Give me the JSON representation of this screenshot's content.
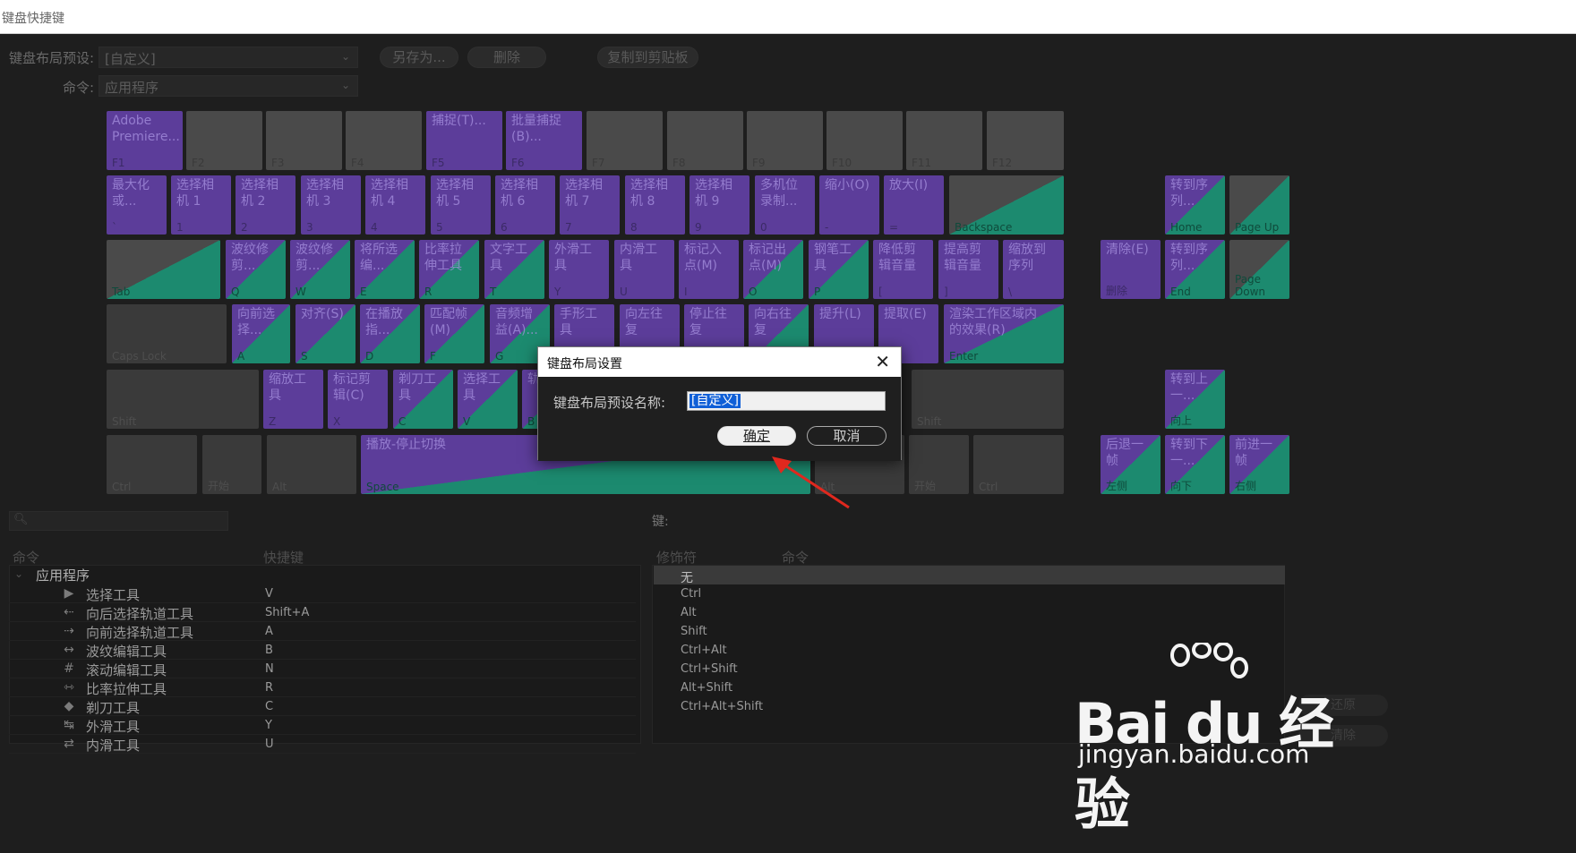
{
  "window": {
    "title": "键盘快捷键"
  },
  "toolbar": {
    "preset_label": "键盘布局预设:",
    "preset_value": "[自定义]",
    "command_label": "命令:",
    "command_value": "应用程序",
    "save_as": "另存为...",
    "delete": "删除",
    "copy_clipboard": "复制到剪贴板"
  },
  "keys": {
    "f1": {
      "label": "Adobe\nPremiere...",
      "base": "F1"
    },
    "f2": {
      "label": "",
      "base": "F2"
    },
    "f3": {
      "label": "",
      "base": "F3"
    },
    "f4": {
      "label": "",
      "base": "F4"
    },
    "f5": {
      "label": "捕捉(T)...",
      "base": "F5"
    },
    "f6": {
      "label": "批量捕捉\n(B)...",
      "base": "F6"
    },
    "f7": {
      "label": "",
      "base": "F7"
    },
    "f8": {
      "label": "",
      "base": "F8"
    },
    "f9": {
      "label": "",
      "base": "F9"
    },
    "f10": {
      "label": "",
      "base": "F10"
    },
    "f11": {
      "label": "",
      "base": "F11"
    },
    "f12": {
      "label": "",
      "base": "F12"
    },
    "grave": {
      "label": "最大化\n或...",
      "base": "`"
    },
    "k1": {
      "label": "选择相\n机 1",
      "base": "1"
    },
    "k2": {
      "label": "选择相\n机 2",
      "base": "2"
    },
    "k3": {
      "label": "选择相\n机 3",
      "base": "3"
    },
    "k4": {
      "label": "选择相\n机 4",
      "base": "4"
    },
    "k5": {
      "label": "选择相\n机 5",
      "base": "5"
    },
    "k6": {
      "label": "选择相\n机 6",
      "base": "6"
    },
    "k7": {
      "label": "选择相\n机 7",
      "base": "7"
    },
    "k8": {
      "label": "选择相\n机 8",
      "base": "8"
    },
    "k9": {
      "label": "选择相\n机 9",
      "base": "9"
    },
    "k0": {
      "label": "多机位\n录制...",
      "base": "0"
    },
    "minus": {
      "label": "缩小(O)",
      "base": "-"
    },
    "equal": {
      "label": "放大(I)",
      "base": "="
    },
    "backspace": {
      "label": "",
      "base": "Backspace"
    },
    "tab": {
      "label": "",
      "base": "Tab"
    },
    "q": {
      "label": "波纹修\n剪...",
      "base": "Q"
    },
    "w": {
      "label": "波纹修\n剪...",
      "base": "W"
    },
    "e": {
      "label": "将所选\n编...",
      "base": "E"
    },
    "r": {
      "label": "比率拉\n伸工具",
      "base": "R"
    },
    "t": {
      "label": "文字工\n具",
      "base": "T"
    },
    "y": {
      "label": "外滑工\n具",
      "base": "Y"
    },
    "u": {
      "label": "内滑工\n具",
      "base": "U"
    },
    "i": {
      "label": "标记入\n点(M)",
      "base": "I"
    },
    "o": {
      "label": "标记出\n点(M)",
      "base": "O"
    },
    "p": {
      "label": "钢笔工\n具",
      "base": "P"
    },
    "lbracket": {
      "label": "降低剪\n辑音量",
      "base": "["
    },
    "rbracket": {
      "label": "提高剪\n辑音量",
      "base": "]"
    },
    "backslash": {
      "label": "缩放到\n序列",
      "base": "\\"
    },
    "capslock": {
      "label": "",
      "base": "Caps Lock"
    },
    "a": {
      "label": "向前选\n择...",
      "base": "A"
    },
    "s": {
      "label": "对齐(S)",
      "base": "S"
    },
    "d": {
      "label": "在播放\n指...",
      "base": "D"
    },
    "f": {
      "label": "匹配帧\n(M)",
      "base": "F"
    },
    "g": {
      "label": "音频增\n益(A)...",
      "base": "G"
    },
    "h": {
      "label": "手形工\n具",
      "base": "H"
    },
    "j": {
      "label": "向左往\n复",
      "base": "J"
    },
    "k": {
      "label": "停止往\n复",
      "base": "K"
    },
    "l": {
      "label": "向右往\n复",
      "base": "L"
    },
    "semicolon": {
      "label": "提升(L)",
      "base": ";"
    },
    "quote": {
      "label": "提取(E)",
      "base": "'"
    },
    "enter": {
      "label": "渲染工作区域内\n的效果(R)",
      "base": "Enter"
    },
    "lshift": {
      "label": "",
      "base": "Shift"
    },
    "z": {
      "label": "缩放工\n具",
      "base": "Z"
    },
    "x": {
      "label": "标记剪\n辑(C)",
      "base": "X"
    },
    "c": {
      "label": "剃刀工\n具",
      "base": "C"
    },
    "v": {
      "label": "选择工\n具",
      "base": "V"
    },
    "b": {
      "label": "轨...",
      "base": "B"
    },
    "rshift": {
      "label": "",
      "base": "Shift"
    },
    "lctrl": {
      "label": "",
      "base": "Ctrl"
    },
    "lwin": {
      "label": "",
      "base": "开始"
    },
    "lalt": {
      "label": "",
      "base": "Alt"
    },
    "space": {
      "label": "播放-停止切换",
      "base": "Space"
    },
    "ralt": {
      "label": "",
      "base": "Alt"
    },
    "rwin": {
      "label": "",
      "base": "开始"
    },
    "rctrl": {
      "label": "",
      "base": "Ctrl"
    },
    "home": {
      "label": "转到序\n列...",
      "base": "Home"
    },
    "pageup": {
      "label": "",
      "base": "Page Up"
    },
    "delete": {
      "label": "清除(E)",
      "base": "删除"
    },
    "end": {
      "label": "转到序\n列...",
      "base": "End"
    },
    "pagedown": {
      "label": "",
      "base": "Page\nDown"
    },
    "up": {
      "label": "转到上\n一...",
      "base": "向上"
    },
    "left": {
      "label": "后退一\n帧",
      "base": "左侧"
    },
    "down": {
      "label": "转到下\n一...",
      "base": "向下"
    },
    "right": {
      "label": "前进一\n帧",
      "base": "右侧"
    }
  },
  "commands": {
    "header_command": "命令",
    "header_shortcut": "快捷键",
    "group": "应用程序",
    "rows": [
      {
        "name": "选择工具",
        "shortcut": "V",
        "icon": "▶"
      },
      {
        "name": "向后选择轨道工具",
        "shortcut": "Shift+A",
        "icon": "⇠"
      },
      {
        "name": "向前选择轨道工具",
        "shortcut": "A",
        "icon": "⇢"
      },
      {
        "name": "波纹编辑工具",
        "shortcut": "B",
        "icon": "↔"
      },
      {
        "name": "滚动编辑工具",
        "shortcut": "N",
        "icon": "#"
      },
      {
        "name": "比率拉伸工具",
        "shortcut": "R",
        "icon": "⇿"
      },
      {
        "name": "剃刀工具",
        "shortcut": "C",
        "icon": "◆"
      },
      {
        "name": "外滑工具",
        "shortcut": "Y",
        "icon": "↹"
      },
      {
        "name": "内滑工具",
        "shortcut": "U",
        "icon": "⇄"
      }
    ]
  },
  "modifiers": {
    "key_label": "键:",
    "header_modifier": "修饰符",
    "header_command": "命令",
    "rows": [
      "无",
      "Ctrl",
      "Alt",
      "Shift",
      "Ctrl+Alt",
      "Ctrl+Shift",
      "Alt+Shift",
      "Ctrl+Alt+Shift"
    ]
  },
  "bottom_buttons": {
    "undo": "还原",
    "clear": "清除"
  },
  "dialog": {
    "title": "键盘布局设置",
    "label": "键盘布局预设名称:",
    "value": "[自定义]",
    "ok": "确定",
    "cancel": "取消"
  },
  "watermark": {
    "brand": "Bai du 经验",
    "url": "jingyan.baidu.com"
  },
  "colors": {
    "purple": "#5c3d9a",
    "green": "#1c8a6f",
    "gray_key": "#4a4a4a",
    "arrow": "#e0281e"
  }
}
